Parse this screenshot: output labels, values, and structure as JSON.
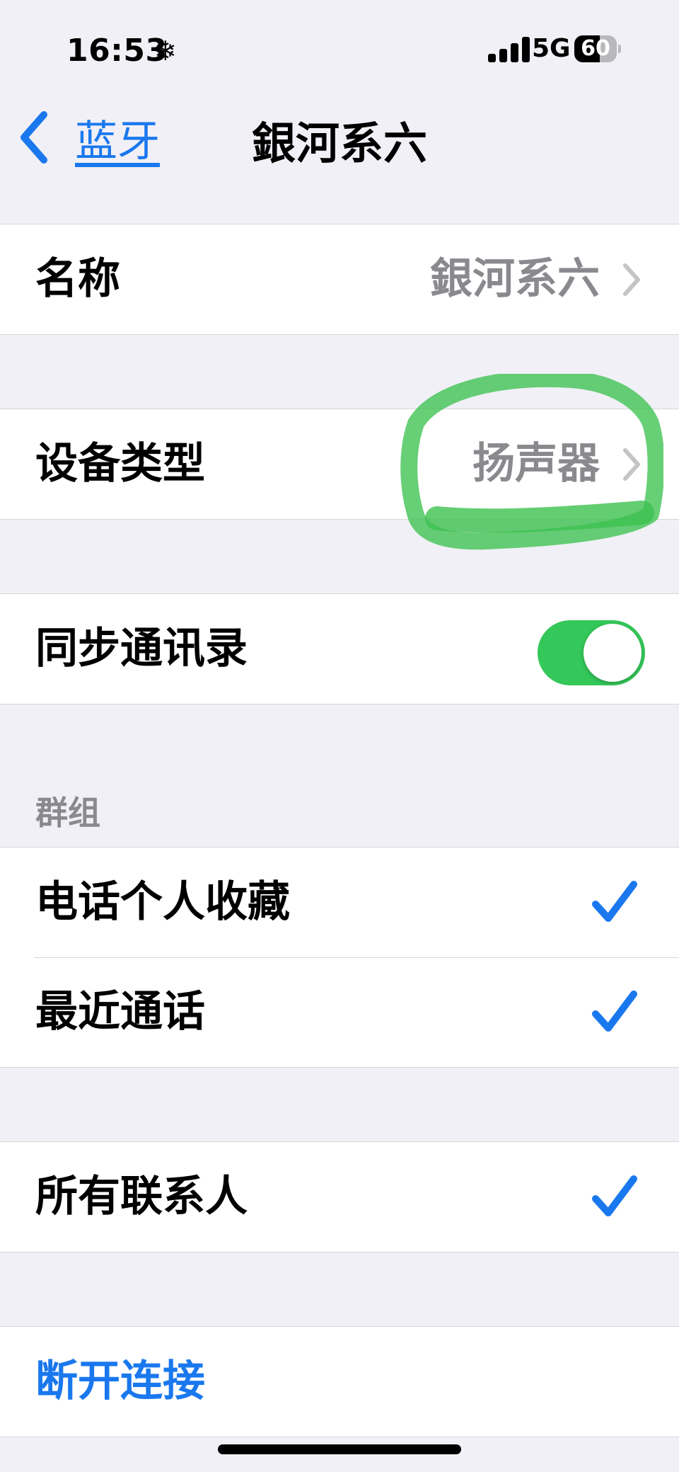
{
  "status_bar": {
    "time": "16:53",
    "focus_symbol": "❄",
    "network": "5G",
    "battery_percent": "60",
    "battery_level": 0.6
  },
  "nav": {
    "back_label": "蓝牙",
    "title": "銀河系六"
  },
  "rows": {
    "name": {
      "label": "名称",
      "value": "銀河系六"
    },
    "device_type": {
      "label": "设备类型",
      "value": "扬声器"
    },
    "sync_contacts": {
      "label": "同步通讯录",
      "toggle_on": true
    }
  },
  "groups_section": {
    "header": "群组",
    "items": [
      {
        "label": "电话个人收藏",
        "checked": true
      },
      {
        "label": "最近通话",
        "checked": true
      }
    ]
  },
  "all_contacts": {
    "label": "所有联系人",
    "checked": true
  },
  "disconnect": {
    "label": "断开连接"
  },
  "colors": {
    "accent": "#1a78ee",
    "toggle_on": "#34c759",
    "highlight": "#3cc14f",
    "background": "#f1f0f6"
  }
}
